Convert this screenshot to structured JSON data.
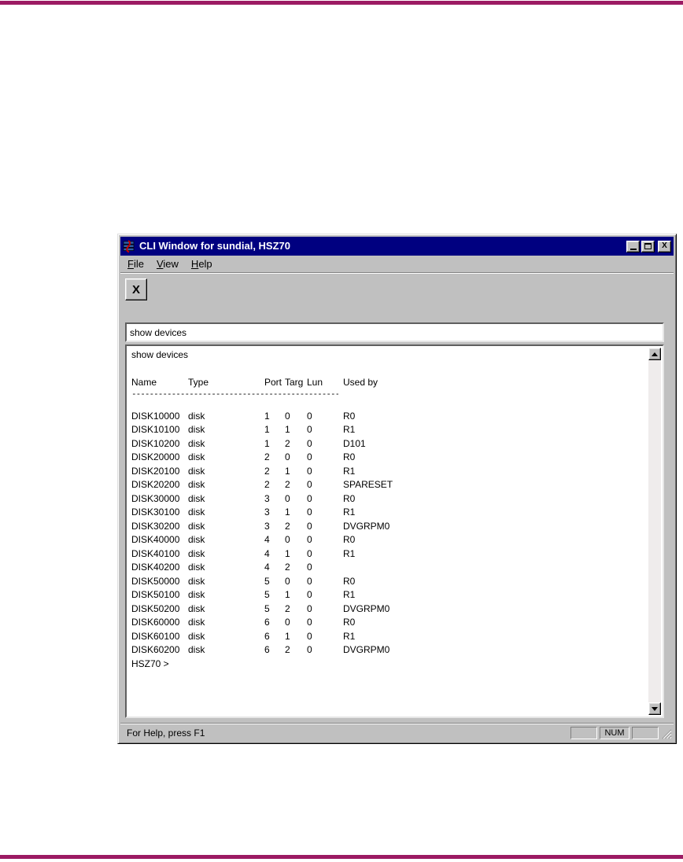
{
  "page": {
    "background": "#ffffff",
    "rule_color": "#9c1a63"
  },
  "window": {
    "title": "CLI Window for sundial, HSZ70",
    "titlebar_color": "#000080",
    "chrome_color": "#c0c0c0",
    "menu_items": [
      {
        "label": "File"
      },
      {
        "label": "View"
      },
      {
        "label": "Help"
      }
    ],
    "icons": {
      "app_icon": "cli-terminal-app-icon",
      "close_glyph": "X",
      "toolbar_exit_glyph": "X"
    }
  },
  "command_input": {
    "value": "show devices"
  },
  "terminal": {
    "echo_line": "show devices",
    "columns": {
      "name": "Name",
      "type": "Type",
      "port": "Port",
      "targ": "Targ",
      "lun": "Lun",
      "used_by": "Used by"
    },
    "divider": "--------------------------------------------------------------------------------",
    "rows": [
      [
        "DISK10000",
        "disk",
        "1",
        "0",
        "0",
        "R0"
      ],
      [
        "DISK10100",
        "disk",
        "1",
        "1",
        "0",
        "R1"
      ],
      [
        "DISK10200",
        "disk",
        "1",
        "2",
        "0",
        "D101"
      ],
      [
        "DISK20000",
        "disk",
        "2",
        "0",
        "0",
        "R0"
      ],
      [
        "DISK20100",
        "disk",
        "2",
        "1",
        "0",
        "R1"
      ],
      [
        "DISK20200",
        "disk",
        "2",
        "2",
        "0",
        "SPARESET"
      ],
      [
        "DISK30000",
        "disk",
        "3",
        "0",
        "0",
        "R0"
      ],
      [
        "DISK30100",
        "disk",
        "3",
        "1",
        "0",
        "R1"
      ],
      [
        "DISK30200",
        "disk",
        "3",
        "2",
        "0",
        "DVGRPM0"
      ],
      [
        "DISK40000",
        "disk",
        "4",
        "0",
        "0",
        "R0"
      ],
      [
        "DISK40100",
        "disk",
        "4",
        "1",
        "0",
        "R1"
      ],
      [
        "DISK40200",
        "disk",
        "4",
        "2",
        "0",
        ""
      ],
      [
        "DISK50000",
        "disk",
        "5",
        "0",
        "0",
        "R0"
      ],
      [
        "DISK50100",
        "disk",
        "5",
        "1",
        "0",
        "R1"
      ],
      [
        "DISK50200",
        "disk",
        "5",
        "2",
        "0",
        "DVGRPM0"
      ],
      [
        "DISK60000",
        "disk",
        "6",
        "0",
        "0",
        "R0"
      ],
      [
        "DISK60100",
        "disk",
        "6",
        "1",
        "0",
        "R1"
      ],
      [
        "DISK60200",
        "disk",
        "6",
        "2",
        "0",
        "DVGRPM0"
      ]
    ],
    "prompt": "HSZ70 >"
  },
  "status_bar": {
    "help_text": "For Help, press F1",
    "num_indicator": "NUM"
  }
}
